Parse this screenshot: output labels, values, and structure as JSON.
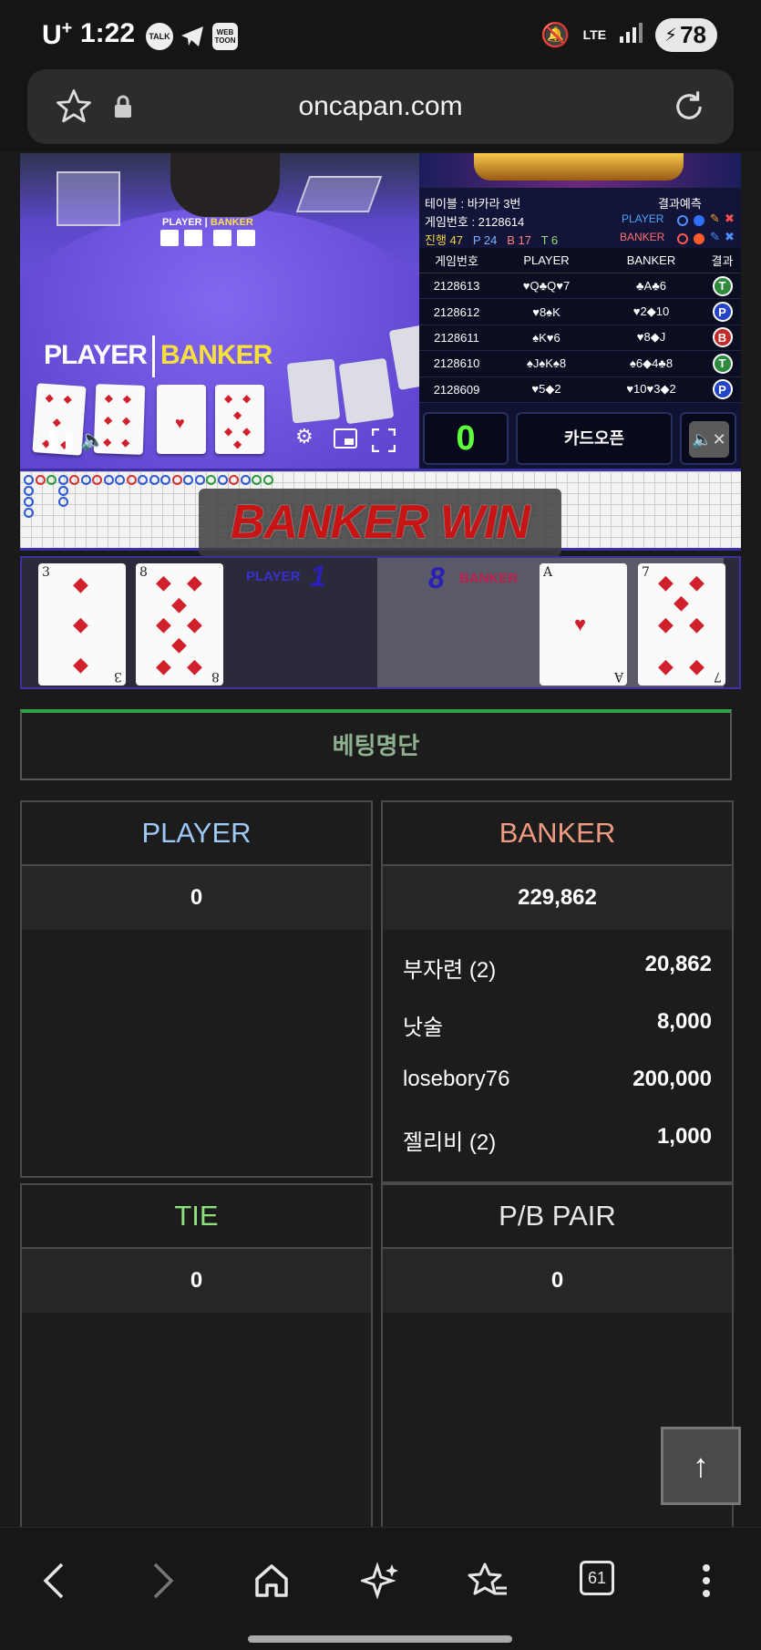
{
  "status_bar": {
    "carrier": "U",
    "carrier_sup": "+",
    "time": "1:22",
    "apps": [
      "TALK",
      "telegram-icon",
      "WEB TOON"
    ],
    "network": "LTE",
    "battery": "78"
  },
  "browser": {
    "url": "oncapan.com"
  },
  "video": {
    "small_player": "PLAYER",
    "small_banker": "BANKER",
    "player_label": "PLAYER",
    "banker_label": "BANKER"
  },
  "panel": {
    "table": "테이블 : 바카라 3번",
    "game_no": "게임번호 : 2128614",
    "progress_label": "진행 47",
    "p_count": "P 24",
    "b_count": "B 17",
    "t_count": "T 6",
    "predict_title": "결과예측",
    "predict_player": "PLAYER",
    "predict_banker": "BANKER",
    "history_headers": [
      "게임번호",
      "PLAYER",
      "BANKER",
      "결과"
    ],
    "history": [
      {
        "no": "2128613",
        "player": "♥Q♣Q♥7",
        "banker": "♣A♣6",
        "result": "T"
      },
      {
        "no": "2128612",
        "player": "♥8♠K",
        "banker": "♥2◆10",
        "result": "P"
      },
      {
        "no": "2128611",
        "player": "♠K♥6",
        "banker": "♥8◆J",
        "result": "B"
      },
      {
        "no": "2128610",
        "player": "♠J♠K♠8",
        "banker": "♠6◆4♣8",
        "result": "T"
      },
      {
        "no": "2128609",
        "player": "♥5◆2",
        "banker": "♥10♥3◆2",
        "result": "P"
      }
    ],
    "counter": "0",
    "card_open": "카드오픈"
  },
  "result": {
    "banner": "BANKER WIN",
    "player_label": "PLAYER",
    "player_score": "1",
    "banker_label": "BANKER",
    "banker_score": "8",
    "player_cards": [
      "3",
      "8"
    ],
    "banker_cards": [
      "A",
      "7"
    ]
  },
  "betting": {
    "title": "베팅명단",
    "player": {
      "label": "PLAYER",
      "total": "0",
      "rows": []
    },
    "banker": {
      "label": "BANKER",
      "total": "229,862",
      "rows": [
        {
          "name": "부자련 (2)",
          "amount": "20,862"
        },
        {
          "name": "낫술",
          "amount": "8,000"
        },
        {
          "name": "losebory76",
          "amount": "200,000"
        },
        {
          "name": "젤리비 (2)",
          "amount": "1,000"
        }
      ]
    },
    "tie": {
      "label": "TIE",
      "total": "0"
    },
    "pair": {
      "label": "P/B PAIR",
      "total": "0"
    }
  },
  "nav": {
    "tab_count": "61"
  },
  "colors": {
    "player": "#9ec9f5",
    "banker": "#f09a82",
    "tie": "#8ee07a",
    "pair": "#e6e6e6",
    "result_T": "#2e8b3e",
    "result_P": "#2444c8",
    "result_B": "#c42a2a"
  }
}
